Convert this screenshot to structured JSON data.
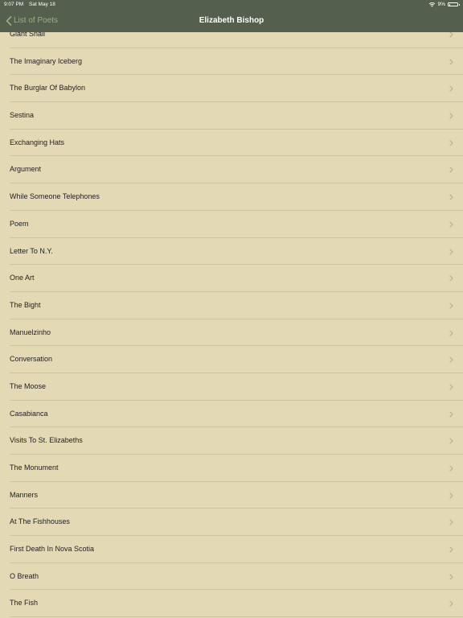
{
  "status_bar": {
    "time": "9:07 PM",
    "date": "Sat May 18",
    "battery_text": "9%",
    "icons": [
      "wifi-icon",
      "battery-icon"
    ]
  },
  "nav": {
    "back_label": "List of Poets",
    "title": "Elizabeth Bishop",
    "back_icon": "chevron-left-icon",
    "accent_color": "#9db07e",
    "bar_color": "#555f4e"
  },
  "list": {
    "row_icon": "chevron-right-icon",
    "background_color": "#e4d9b5",
    "items": [
      {
        "label": "Giant Snail"
      },
      {
        "label": "The Imaginary Iceberg"
      },
      {
        "label": "The Burglar Of Babylon"
      },
      {
        "label": "Sestina"
      },
      {
        "label": "Exchanging Hats"
      },
      {
        "label": "Argument"
      },
      {
        "label": "While Someone Telephones"
      },
      {
        "label": "Poem"
      },
      {
        "label": "Letter To N.Y."
      },
      {
        "label": "One Art"
      },
      {
        "label": "The Bight"
      },
      {
        "label": "Manuelzinho"
      },
      {
        "label": "Conversation"
      },
      {
        "label": "The Moose"
      },
      {
        "label": "Casabianca"
      },
      {
        "label": "Visits To St. Elizabeths"
      },
      {
        "label": "The Monument"
      },
      {
        "label": "Manners"
      },
      {
        "label": "At The Fishhouses"
      },
      {
        "label": "First Death In Nova Scotia"
      },
      {
        "label": "O Breath"
      },
      {
        "label": "The Fish"
      }
    ]
  }
}
